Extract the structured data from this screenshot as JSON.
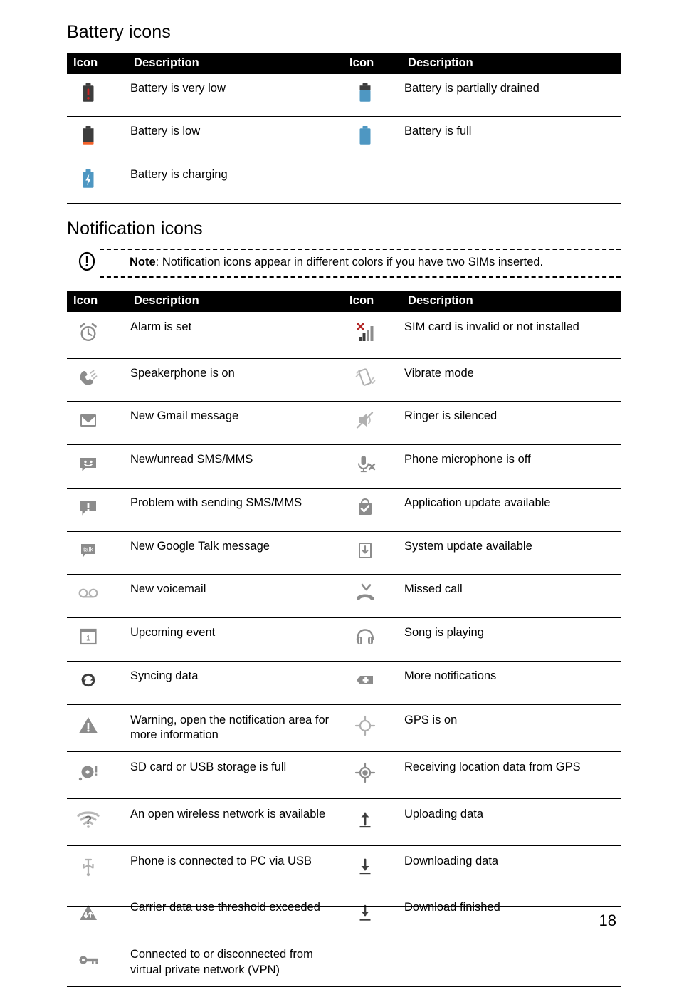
{
  "document": {
    "page_number": "18"
  },
  "battery_section": {
    "title": "Battery icons",
    "headers": {
      "icon_left": "Icon",
      "desc_left": "Description",
      "icon_right": "Icon",
      "desc_right": "Description"
    },
    "rows": [
      {
        "left_icon": "battery-very-low-icon",
        "left_desc": "Battery is very low",
        "right_icon": "battery-partially-drained-icon",
        "right_desc": "Battery is partially drained"
      },
      {
        "left_icon": "battery-low-icon",
        "left_desc": "Battery is low",
        "right_icon": "battery-full-icon",
        "right_desc": "Battery is full"
      },
      {
        "left_icon": "battery-charging-icon",
        "left_desc": "Battery is charging",
        "right_icon": "",
        "right_desc": ""
      }
    ]
  },
  "notification_section": {
    "title": "Notification icons",
    "note": {
      "icon": "exclamation-circle-icon",
      "label": "Note",
      "separator": ": ",
      "text": "Notification icons appear in different colors if you have two SIMs inserted."
    },
    "headers": {
      "icon_left": "Icon",
      "desc_left": "Description",
      "icon_right": "Icon",
      "desc_right": "Description"
    },
    "rows": [
      {
        "left_icon": "alarm-clock-icon",
        "left_desc": "Alarm is set",
        "right_icon": "sim-invalid-signal-icon",
        "right_desc": "SIM card is invalid or not installed"
      },
      {
        "left_icon": "speakerphone-icon",
        "left_desc": "Speakerphone is on",
        "right_icon": "vibrate-icon",
        "right_desc": "Vibrate mode"
      },
      {
        "left_icon": "gmail-icon",
        "left_desc": "New Gmail message",
        "right_icon": "ringer-silenced-icon",
        "right_desc": "Ringer is silenced"
      },
      {
        "left_icon": "sms-smiley-icon",
        "left_desc": "New/unread SMS/MMS",
        "right_icon": "microphone-off-icon",
        "right_desc": "Phone microphone is off"
      },
      {
        "left_icon": "sms-problem-icon",
        "left_desc": "Problem with sending SMS/MMS",
        "right_icon": "app-update-bag-icon",
        "right_desc": "Application update available"
      },
      {
        "left_icon": "google-talk-icon",
        "left_desc": "New Google Talk message",
        "right_icon": "system-update-icon",
        "right_desc": "System update available"
      },
      {
        "left_icon": "voicemail-icon",
        "left_desc": "New voicemail",
        "right_icon": "missed-call-icon",
        "right_desc": "Missed call"
      },
      {
        "left_icon": "calendar-event-icon",
        "left_desc": "Upcoming event",
        "right_icon": "headphones-icon",
        "right_desc": "Song is playing"
      },
      {
        "left_icon": "sync-icon",
        "left_desc": "Syncing data",
        "right_icon": "more-notifications-icon",
        "right_desc": "More notifications"
      },
      {
        "left_icon": "warning-triangle-icon",
        "left_desc": "Warning, open the notification area for more information",
        "right_icon": "gps-on-icon",
        "right_desc": "GPS is on"
      },
      {
        "left_icon": "sd-card-full-icon",
        "left_desc": "SD card or USB storage is full",
        "right_icon": "gps-fix-icon",
        "right_desc": "Receiving location data from GPS"
      },
      {
        "left_icon": "open-wifi-icon",
        "left_desc": "An open wireless network is available",
        "right_icon": "upload-icon",
        "right_desc": "Uploading data"
      },
      {
        "left_icon": "usb-icon",
        "left_desc": "Phone is connected to PC via USB",
        "right_icon": "download-icon",
        "right_desc": "Downloading data"
      },
      {
        "left_icon": "data-threshold-icon",
        "left_desc": "Carrier data use threshold exceeded",
        "right_icon": "download-finished-icon",
        "right_desc": "Download finished"
      },
      {
        "left_icon": "vpn-key-icon",
        "left_desc": "Connected to or disconnected from virtual private network (VPN)",
        "right_icon": "",
        "right_desc": ""
      }
    ]
  },
  "colors": {
    "battery_blue": "#4e97c2",
    "battery_dark": "#3d3d3d",
    "battery_red": "#cc2222",
    "battery_orange": "#f4622a",
    "icon_gray": "#8c8c8c",
    "icon_dark_gray": "#666666",
    "sim_x_red": "#b32424",
    "header_bg": "#000000",
    "header_fg": "#ffffff"
  }
}
